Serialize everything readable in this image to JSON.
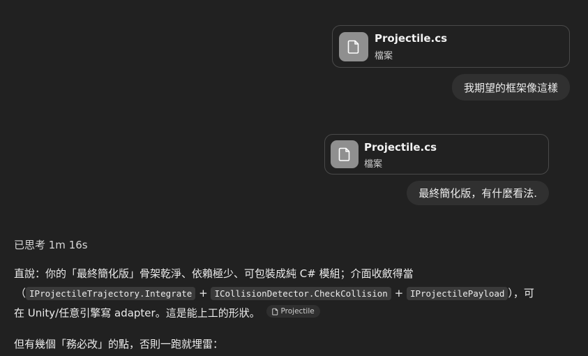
{
  "conversation": {
    "message1": {
      "attachment": {
        "name": "Projectile.cs",
        "type": "檔案",
        "icon": "file-icon"
      },
      "text": "我期望的框架像這樣"
    },
    "message2": {
      "attachment": {
        "name": "Projectile.cs",
        "type": "檔案",
        "icon": "file-icon"
      },
      "text": "最終簡化版，有什麼看法."
    }
  },
  "response": {
    "thought_label": "已思考 1m 16s",
    "para1_text1": "直說：你的「最終簡化版」骨架乾淨、依賴極少、可包裝成純 C# 模組；介面收斂得當",
    "para1_paren_open": "（",
    "code1": "IProjectileTrajectory.Integrate",
    "plus1": "+",
    "code2": "ICollisionDetector.CheckCollision",
    "plus2": "+",
    "code3": "IProjectilePayload",
    "para1_paren_close": "），可",
    "para1_text2": "在 Unity/任意引擎寫 adapter。這是能上工的形狀。",
    "citation_chip": "Projectile",
    "para2_text": "但有幾個「務必改」的點，否則一跑就埋雷："
  },
  "colors": {
    "background": "#212121",
    "bubble": "#303030",
    "card_border": "#4a4a4a",
    "icon_bg": "#8f8f8f",
    "code_bg": "#3a3a3a"
  }
}
